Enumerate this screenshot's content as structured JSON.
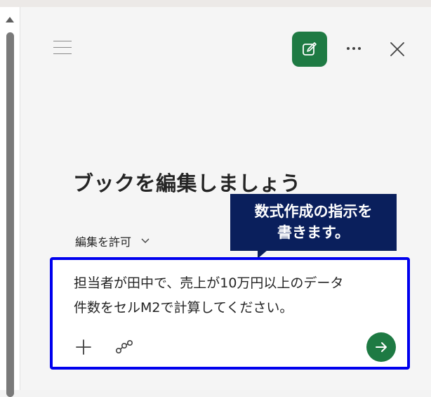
{
  "header": {
    "menu_icon": "hamburger-icon",
    "new_chat_icon": "compose-icon",
    "more_icon": "more-horizontal-icon",
    "close_icon": "close-icon",
    "accent_color": "#1e7a43"
  },
  "main": {
    "title": "ブックを編集しましょう",
    "permission_label": "編集を許可",
    "permission_icon": "chevron-down-icon"
  },
  "callout": {
    "line1": "数式作成の指示を",
    "line2": "書きます。",
    "background": "#0a1f5c"
  },
  "composer": {
    "prompt_line1": "担当者が田中で、売上が10万円以上のデータ",
    "prompt_line2": "件数をセルM2で計算してください。",
    "attach_icon": "plus-icon",
    "link_icon": "link-nodes-icon",
    "send_icon": "arrow-right-icon",
    "highlight_border": "#0000ee"
  }
}
